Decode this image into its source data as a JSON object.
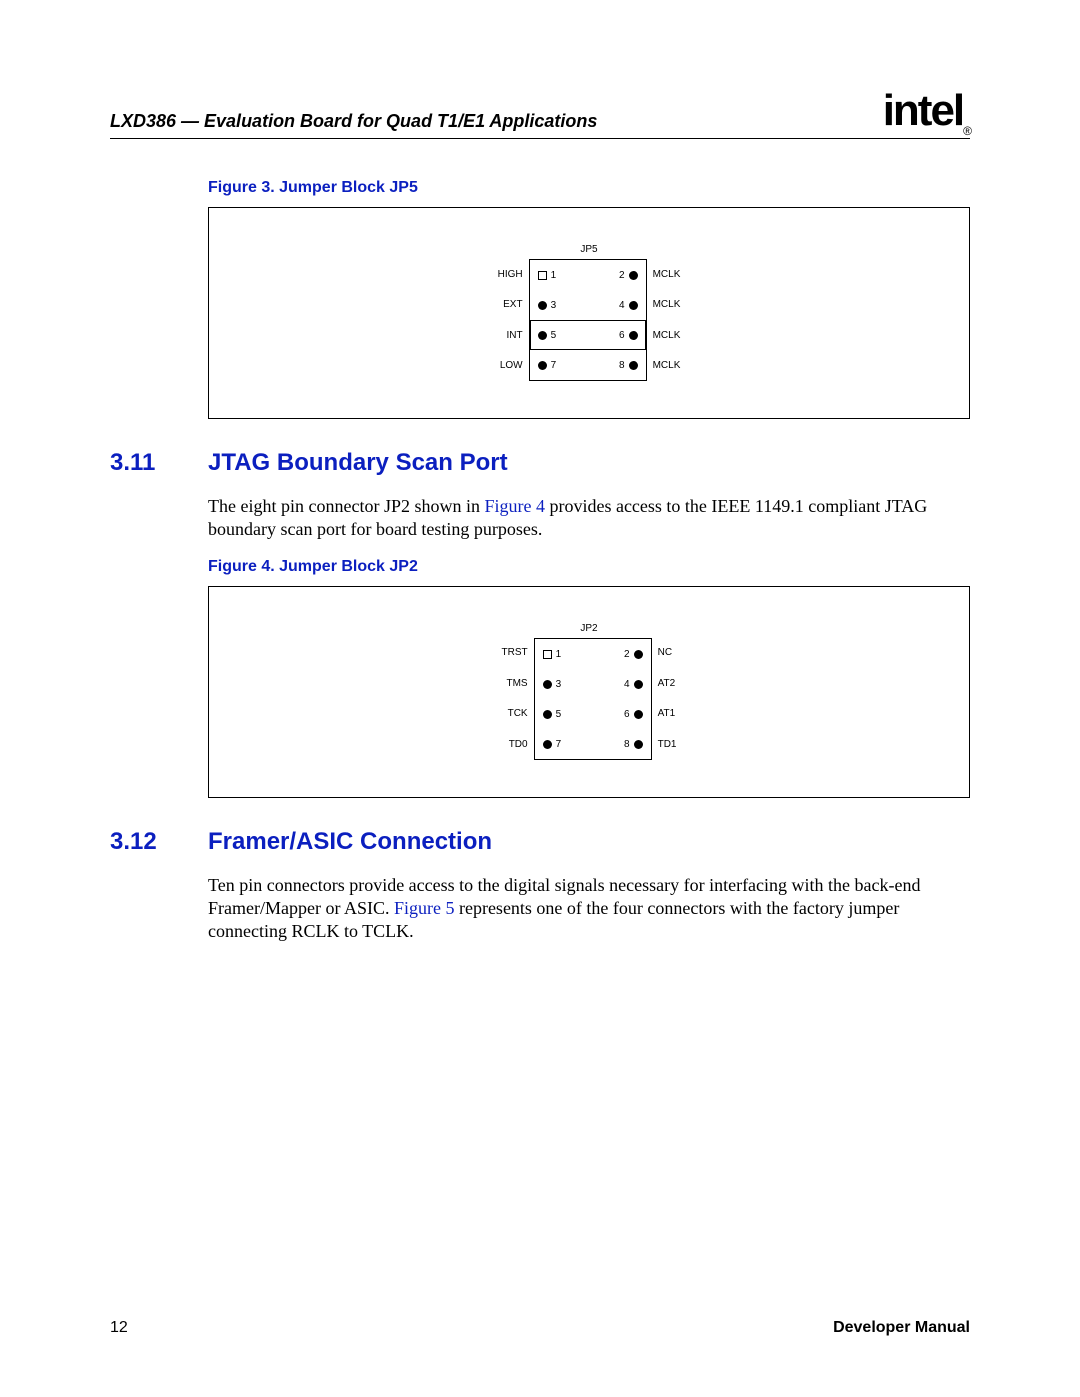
{
  "header": {
    "title": "LXD386 — Evaluation Board for Quad T1/E1 Applications",
    "logo_text": "intel",
    "logo_reg": "®"
  },
  "figure3": {
    "caption": "Figure 3. Jumper Block JP5",
    "block_label": "JP5",
    "left_labels": [
      "HIGH",
      "EXT",
      "INT",
      "LOW"
    ],
    "right_labels": [
      "MCLK",
      "MCLK",
      "MCLK",
      "MCLK"
    ],
    "pins": [
      {
        "ln": "1",
        "rn": "2",
        "lshape": "sq",
        "boxed": false
      },
      {
        "ln": "3",
        "rn": "4",
        "lshape": "dot",
        "boxed": false
      },
      {
        "ln": "5",
        "rn": "6",
        "lshape": "dot",
        "boxed": true
      },
      {
        "ln": "7",
        "rn": "8",
        "lshape": "dot",
        "boxed": false
      }
    ]
  },
  "section311": {
    "num": "3.11",
    "title": "JTAG Boundary Scan Port",
    "text_a": "The eight pin connector JP2 shown in ",
    "link": "Figure 4",
    "text_b": " provides access to the IEEE 1149.1 compliant JTAG boundary scan port for board testing purposes."
  },
  "figure4": {
    "caption": "Figure 4. Jumper Block JP2",
    "block_label": "JP2",
    "left_labels": [
      "TRST",
      "TMS",
      "TCK",
      "TD0"
    ],
    "right_labels": [
      "NC",
      "AT2",
      "AT1",
      "TD1"
    ],
    "pins": [
      {
        "ln": "1",
        "rn": "2",
        "lshape": "sq",
        "boxed": false
      },
      {
        "ln": "3",
        "rn": "4",
        "lshape": "dot",
        "boxed": false
      },
      {
        "ln": "5",
        "rn": "6",
        "lshape": "dot",
        "boxed": false
      },
      {
        "ln": "7",
        "rn": "8",
        "lshape": "dot",
        "boxed": false
      }
    ]
  },
  "section312": {
    "num": "3.12",
    "title": "Framer/ASIC Connection",
    "text_a": "Ten pin connectors provide access to the digital signals necessary for interfacing with the back-end Framer/Mapper or ASIC. ",
    "link": "Figure 5",
    "text_b": " represents one of the four connectors with the factory jumper connecting RCLK to TCLK."
  },
  "footer": {
    "page": "12",
    "label": "Developer Manual"
  }
}
